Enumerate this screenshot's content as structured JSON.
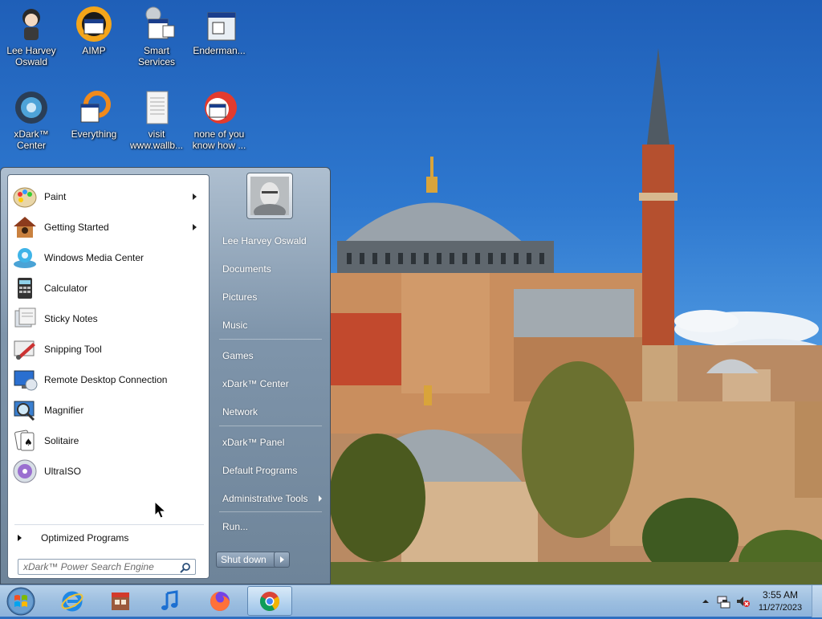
{
  "desktop": {
    "icons": [
      {
        "label": "Lee Harvey Oswald"
      },
      {
        "label": "AIMP"
      },
      {
        "label": "Smart Services"
      },
      {
        "label": "Enderman..."
      },
      {
        "label": "xDark™ Center"
      },
      {
        "label": "Everything"
      },
      {
        "label": "visit www.wallb..."
      },
      {
        "label": "none of you know how ..."
      }
    ]
  },
  "start_menu": {
    "programs": [
      {
        "label": "Paint",
        "has_submenu": true,
        "icon": "paint-icon"
      },
      {
        "label": "Getting Started",
        "has_submenu": true,
        "icon": "getting-started-icon"
      },
      {
        "label": "Windows Media Center",
        "has_submenu": false,
        "icon": "media-center-icon"
      },
      {
        "label": "Calculator",
        "has_submenu": false,
        "icon": "calculator-icon"
      },
      {
        "label": "Sticky Notes",
        "has_submenu": false,
        "icon": "sticky-notes-icon"
      },
      {
        "label": "Snipping Tool",
        "has_submenu": false,
        "icon": "snipping-tool-icon"
      },
      {
        "label": "Remote Desktop Connection",
        "has_submenu": false,
        "icon": "remote-desktop-icon"
      },
      {
        "label": "Magnifier",
        "has_submenu": false,
        "icon": "magnifier-icon"
      },
      {
        "label": "Solitaire",
        "has_submenu": false,
        "icon": "solitaire-icon"
      },
      {
        "label": "UltraISO",
        "has_submenu": false,
        "icon": "ultraiso-icon"
      }
    ],
    "all_programs_label": "Optimized Programs",
    "search_placeholder": "xDark™ Power Search Engine",
    "right_items": [
      {
        "label": "Lee Harvey Oswald"
      },
      {
        "label": "Documents"
      },
      {
        "label": "Pictures"
      },
      {
        "label": "Music"
      },
      {
        "label": "Games"
      },
      {
        "label": "xDark™ Center"
      },
      {
        "label": "Network"
      },
      {
        "label": "xDark™ Panel"
      },
      {
        "label": "Default Programs"
      },
      {
        "label": "Administrative Tools",
        "has_submenu": true
      },
      {
        "label": "Run..."
      }
    ],
    "shutdown_label": "Shut down"
  },
  "taskbar": {
    "pinned": [
      {
        "icon": "internet-explorer-icon"
      },
      {
        "icon": "store-icon"
      },
      {
        "icon": "music-icon"
      },
      {
        "icon": "firefox-icon"
      },
      {
        "icon": "chrome-icon",
        "active": true
      }
    ],
    "clock": {
      "time": "3:55 AM",
      "date": "11/27/2023"
    }
  },
  "colors": {
    "accent": "#7f95ab",
    "taskbar": "#9dbfe0",
    "sky": "#2e78cf"
  }
}
